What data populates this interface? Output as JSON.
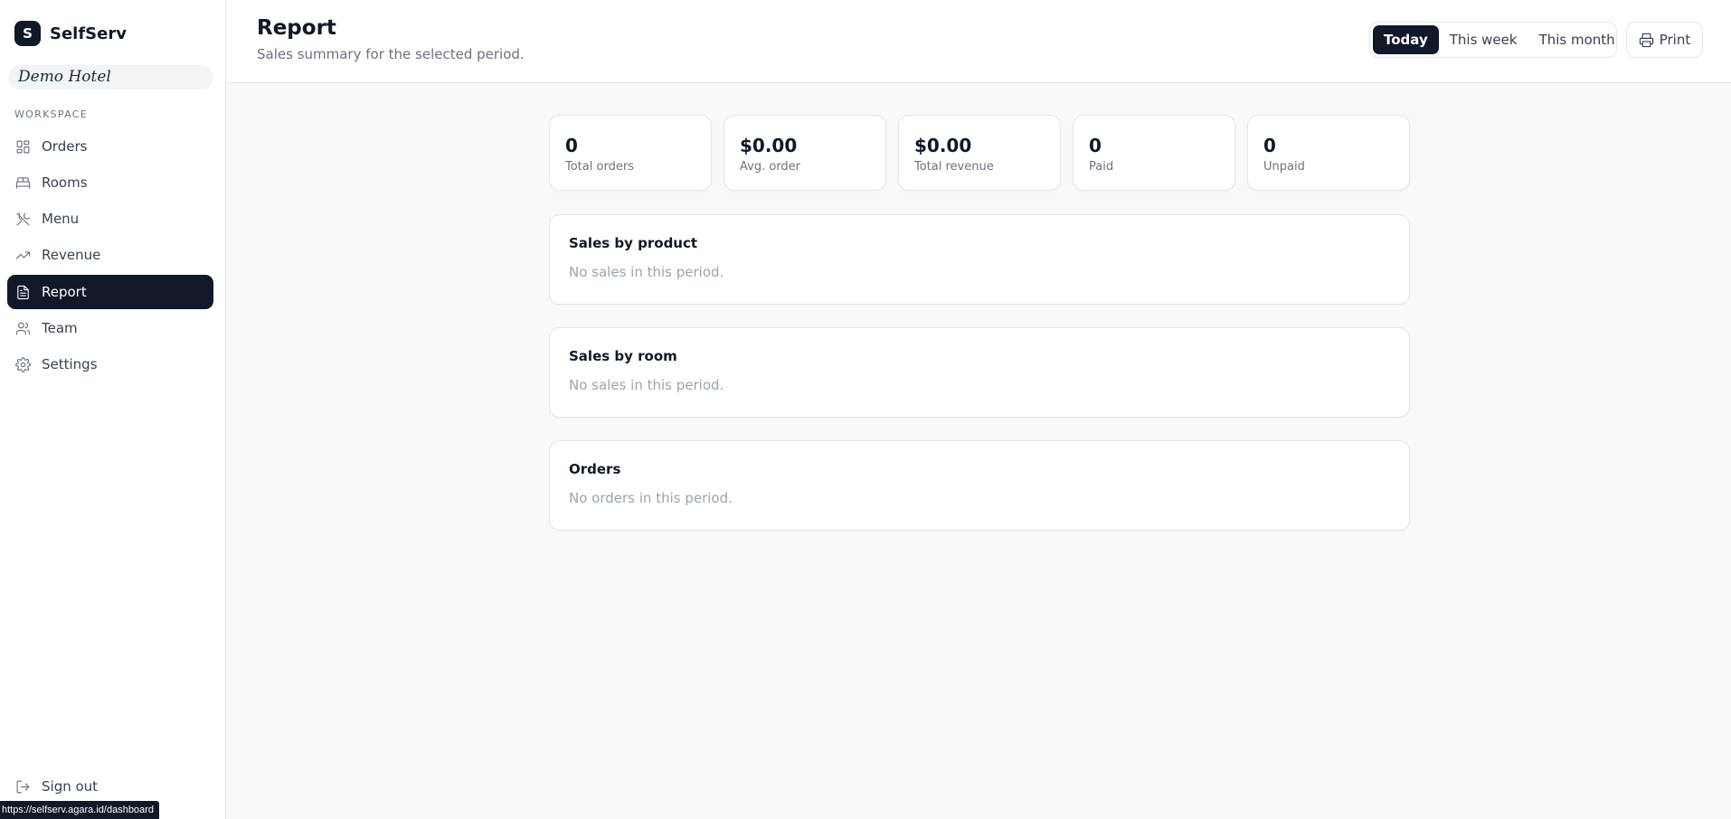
{
  "brand": {
    "logo_letter": "S",
    "name": "SelfServ"
  },
  "hotel": {
    "name": "Demo Hotel"
  },
  "sidebar": {
    "section_label": "WORKSPACE",
    "items": [
      {
        "label": "Orders",
        "icon": "grid-icon",
        "active": false
      },
      {
        "label": "Rooms",
        "icon": "bed-icon",
        "active": false
      },
      {
        "label": "Menu",
        "icon": "utensils-icon",
        "active": false
      },
      {
        "label": "Revenue",
        "icon": "trending-up-icon",
        "active": false
      },
      {
        "label": "Report",
        "icon": "document-icon",
        "active": true
      },
      {
        "label": "Team",
        "icon": "users-icon",
        "active": false
      },
      {
        "label": "Settings",
        "icon": "gear-icon",
        "active": false
      }
    ],
    "signout_label": "Sign out"
  },
  "status_bar": {
    "url": "https://selfserv.agara.id/dashboard"
  },
  "header": {
    "title": "Report",
    "subtitle": "Sales summary for the selected period.",
    "periods": [
      "Today",
      "This week",
      "This month"
    ],
    "selected_period": "Today",
    "print_label": "Print"
  },
  "stats": [
    {
      "value": "0",
      "label": "Total orders"
    },
    {
      "value": "$0.00",
      "label": "Avg. order"
    },
    {
      "value": "$0.00",
      "label": "Total revenue"
    },
    {
      "value": "0",
      "label": "Paid"
    },
    {
      "value": "0",
      "label": "Unpaid"
    }
  ],
  "panels": [
    {
      "title": "Sales by product",
      "empty": "No sales in this period."
    },
    {
      "title": "Sales by room",
      "empty": "No sales in this period."
    },
    {
      "title": "Orders",
      "empty": "No orders in this period."
    }
  ],
  "colors": {
    "primary": "#111827",
    "muted": "#6b7280",
    "border": "#e5e7eb",
    "background": "#f8f9fb"
  }
}
